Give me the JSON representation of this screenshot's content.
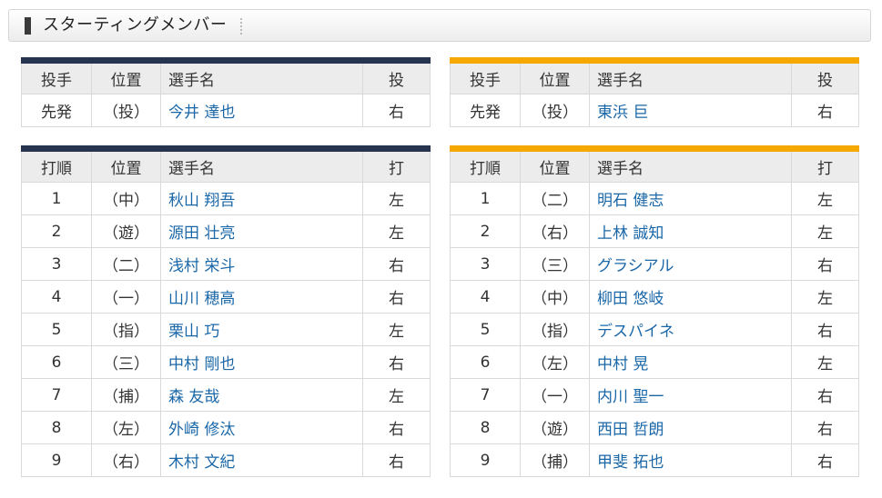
{
  "section": {
    "title": "スターティングメンバー"
  },
  "team_a": {
    "pitcher_table": {
      "headers": [
        "投手",
        "位置",
        "選手名",
        "投"
      ],
      "rows": [
        {
          "order": "先発",
          "pos": "（投）",
          "name": "今井 達也",
          "hand": "右"
        }
      ]
    },
    "batter_table": {
      "headers": [
        "打順",
        "位置",
        "選手名",
        "打"
      ],
      "rows": [
        {
          "order": "1",
          "pos": "（中）",
          "name": "秋山 翔吾",
          "hand": "左"
        },
        {
          "order": "2",
          "pos": "（遊）",
          "name": "源田 壮亮",
          "hand": "左"
        },
        {
          "order": "3",
          "pos": "（二）",
          "name": "浅村 栄斗",
          "hand": "右"
        },
        {
          "order": "4",
          "pos": "（一）",
          "name": "山川 穂高",
          "hand": "右"
        },
        {
          "order": "5",
          "pos": "（指）",
          "name": "栗山 巧",
          "hand": "左"
        },
        {
          "order": "6",
          "pos": "（三）",
          "name": "中村 剛也",
          "hand": "右"
        },
        {
          "order": "7",
          "pos": "（捕）",
          "name": "森 友哉",
          "hand": "左"
        },
        {
          "order": "8",
          "pos": "（左）",
          "name": "外崎 修汰",
          "hand": "右"
        },
        {
          "order": "9",
          "pos": "（右）",
          "name": "木村 文紀",
          "hand": "右"
        }
      ]
    }
  },
  "team_b": {
    "pitcher_table": {
      "headers": [
        "投手",
        "位置",
        "選手名",
        "投"
      ],
      "rows": [
        {
          "order": "先発",
          "pos": "（投）",
          "name": "東浜 巨",
          "hand": "右"
        }
      ]
    },
    "batter_table": {
      "headers": [
        "打順",
        "位置",
        "選手名",
        "打"
      ],
      "rows": [
        {
          "order": "1",
          "pos": "（二）",
          "name": "明石 健志",
          "hand": "左"
        },
        {
          "order": "2",
          "pos": "（右）",
          "name": "上林 誠知",
          "hand": "左"
        },
        {
          "order": "3",
          "pos": "（三）",
          "name": "グラシアル",
          "hand": "右"
        },
        {
          "order": "4",
          "pos": "（中）",
          "name": "柳田 悠岐",
          "hand": "左"
        },
        {
          "order": "5",
          "pos": "（指）",
          "name": "デスパイネ",
          "hand": "右"
        },
        {
          "order": "6",
          "pos": "（左）",
          "name": "中村 晃",
          "hand": "左"
        },
        {
          "order": "7",
          "pos": "（一）",
          "name": "内川 聖一",
          "hand": "右"
        },
        {
          "order": "8",
          "pos": "（遊）",
          "name": "西田 哲朗",
          "hand": "右"
        },
        {
          "order": "9",
          "pos": "（捕）",
          "name": "甲斐 拓也",
          "hand": "右"
        }
      ]
    }
  },
  "colors": {
    "team_a_accent": "#27344f",
    "team_b_accent": "#f5a900",
    "player_link": "#1a67a8"
  }
}
